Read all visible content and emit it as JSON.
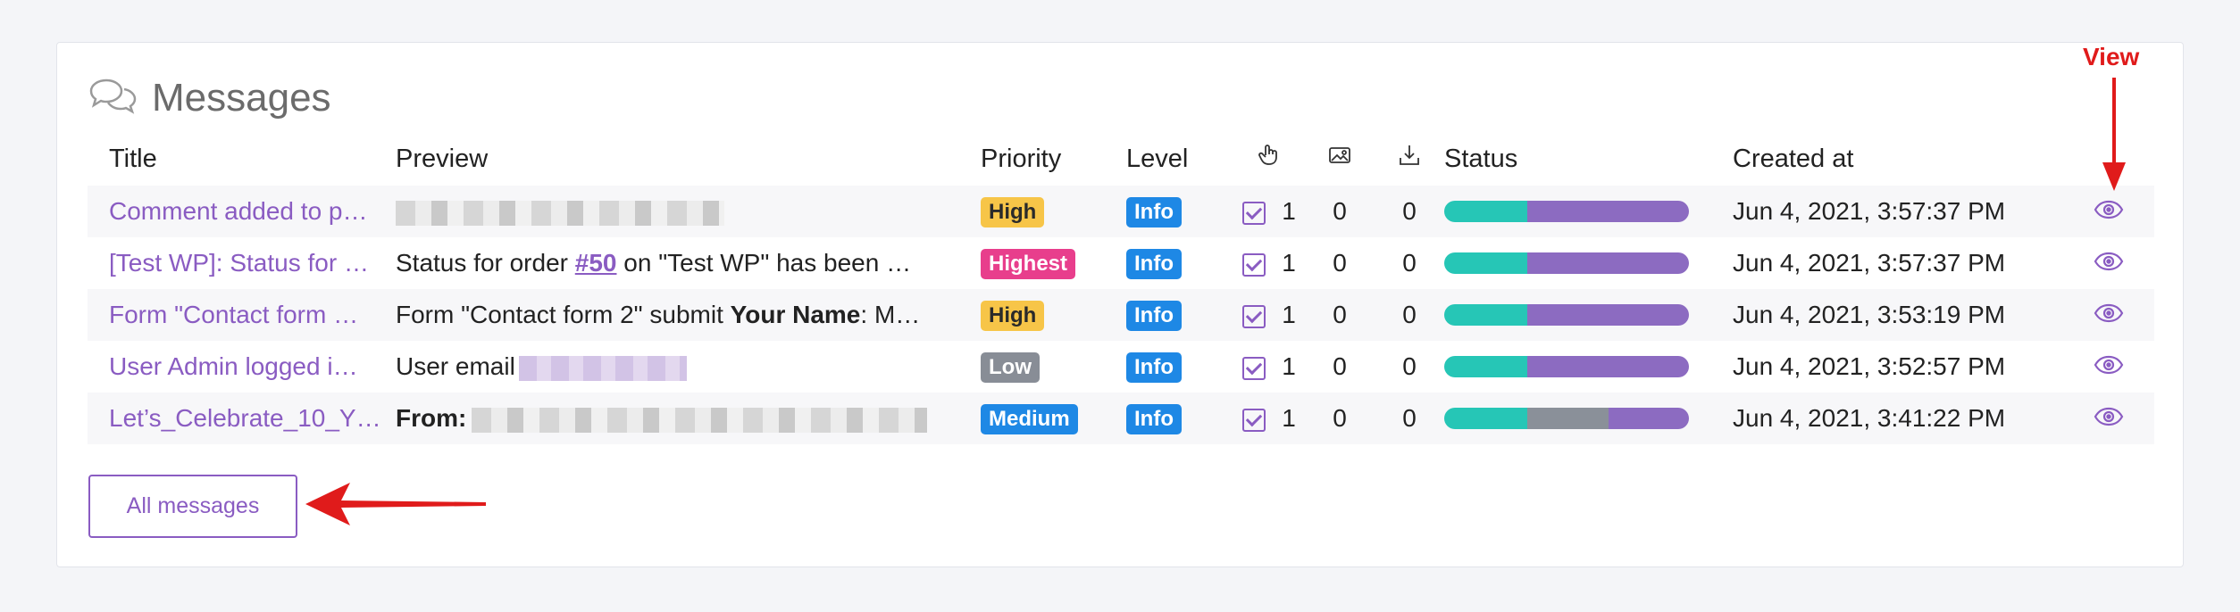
{
  "panel": {
    "title": "Messages",
    "icon": "chat-bubbles-icon",
    "all_messages_label": "All messages",
    "annotation_view": "View"
  },
  "columns": {
    "title": "Title",
    "preview": "Preview",
    "priority": "Priority",
    "level": "Level",
    "clicks_icon": "hand-pointer-icon",
    "images_icon": "image-icon",
    "downloads_icon": "download-icon",
    "status": "Status",
    "created_at": "Created at"
  },
  "colors": {
    "accent": "#8a5cc2",
    "high": "#f7c548",
    "highest": "#e83e8c",
    "low": "#888d96",
    "medium": "#1e88e5",
    "info": "#1e88e5",
    "status_teal": "#26c6b6",
    "status_gray": "#8a9099",
    "status_purple": "#8c6bc1",
    "annotation_red": "#e01b1b"
  },
  "rows": [
    {
      "title": "Comment added to p…",
      "preview_text": "",
      "priority": "High",
      "level": "Info",
      "clicks": "1",
      "images": "0",
      "downloads": "0",
      "status_split": [
        0.34,
        0,
        0.66
      ],
      "created_at": "Jun 4, 2021, 3:57:37 PM"
    },
    {
      "title": "[Test WP]: Status for …",
      "preview_pre": "Status for order ",
      "preview_link": "#50",
      "preview_post": " on \"Test WP\" has been …",
      "priority": "Highest",
      "level": "Info",
      "clicks": "1",
      "images": "0",
      "downloads": "0",
      "status_split": [
        0.34,
        0,
        0.66
      ],
      "created_at": "Jun 4, 2021, 3:57:37 PM"
    },
    {
      "title": "Form \"Contact form …",
      "preview_pre": "Form \"Contact form 2\" submit ",
      "preview_bold": "Your Name",
      "preview_post": ": M…",
      "priority": "High",
      "level": "Info",
      "clicks": "1",
      "images": "0",
      "downloads": "0",
      "status_split": [
        0.34,
        0,
        0.66
      ],
      "created_at": "Jun 4, 2021, 3:53:19 PM"
    },
    {
      "title": "User Admin logged i…",
      "preview_pre": "User email",
      "priority": "Low",
      "level": "Info",
      "clicks": "1",
      "images": "0",
      "downloads": "0",
      "status_split": [
        0.34,
        0,
        0.66
      ],
      "created_at": "Jun 4, 2021, 3:52:57 PM"
    },
    {
      "title": "Let’s_Celebrate_10_Y…",
      "preview_bold": "From:",
      "priority": "Medium",
      "level": "Info",
      "clicks": "1",
      "images": "0",
      "downloads": "0",
      "status_split": [
        0.34,
        0.33,
        0.33
      ],
      "created_at": "Jun 4, 2021, 3:41:22 PM"
    }
  ]
}
